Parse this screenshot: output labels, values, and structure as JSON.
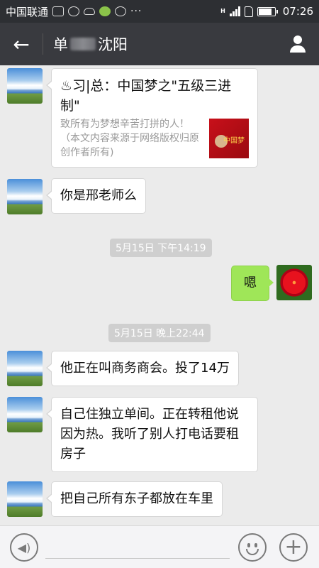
{
  "status_bar": {
    "carrier": "中国联通",
    "time": "07:26",
    "dots": "···",
    "network_label": "H",
    "icons": [
      "image-icon",
      "robot-icon",
      "cloud-icon",
      "globe-icon",
      "compass-icon",
      "more-icon",
      "signal-icon",
      "sim-icon",
      "battery-icon"
    ],
    "battery_level": 0.85
  },
  "header": {
    "back_icon": "arrow-left-icon",
    "title_prefix": "单",
    "title_suffix": "沈阳",
    "profile_icon": "person-icon"
  },
  "messages": {
    "card": {
      "title": "♨习|总：中国梦之\"五级三进制\"",
      "desc": "致所有为梦想辛苦打拼的人！（本文内容来源于网络版权归原创作者所有)",
      "thumb_text": "中国梦"
    },
    "m1": "你是邢老师么",
    "ts1": "5月15日 下午14:19",
    "m2": "嗯",
    "ts2": "5月15日 晚上22:44",
    "m3": "他正在叫商务商会。投了14万",
    "m4": "自己住独立单间。正在转租他说因为热。我听了别人打电话要租房子",
    "m5": "把自己所有东子都放在车里"
  },
  "input_bar": {
    "voice_icon": "voice-icon",
    "voice_glyph": "◀)",
    "emoji_icon": "smiley-icon",
    "plus_icon": "plus-icon",
    "plus_glyph": "+"
  }
}
